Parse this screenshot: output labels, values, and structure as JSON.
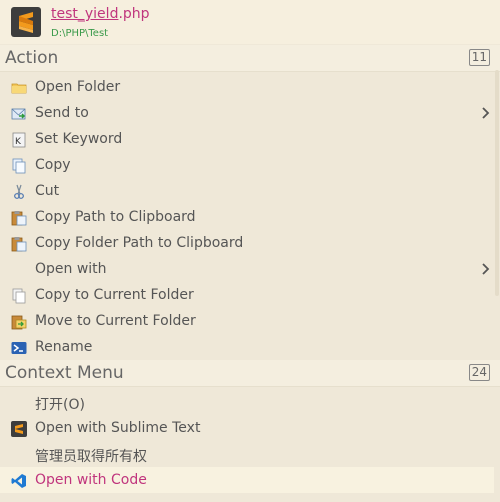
{
  "header": {
    "file_match": "test_yield",
    "file_ext": ".php",
    "path": "D:\\PHP\\Test"
  },
  "sections": [
    {
      "title": "Action",
      "count": "11",
      "items": [
        {
          "label": "Open Folder",
          "icon": "folder-icon"
        },
        {
          "label": "Send to",
          "icon": "send-to-icon",
          "submenu": true
        },
        {
          "label": "Set Keyword",
          "icon": "keyword-icon"
        },
        {
          "label": "Copy",
          "icon": "copy-icon"
        },
        {
          "label": "Cut",
          "icon": "scissors-icon"
        },
        {
          "label": "Copy Path to Clipboard",
          "icon": "clipboard-icon"
        },
        {
          "label": "Copy Folder Path to Clipboard",
          "icon": "clipboard-icon"
        },
        {
          "label": "Open with",
          "icon": "",
          "submenu": true
        },
        {
          "label": "Copy to Current Folder",
          "icon": "copy-icon"
        },
        {
          "label": "Move to Current Folder",
          "icon": "move-icon"
        },
        {
          "label": "Rename",
          "icon": "rename-icon"
        }
      ]
    },
    {
      "title": "Context Menu",
      "count": "24",
      "items": [
        {
          "label": "打开(O)",
          "icon": ""
        },
        {
          "label": "Open with Sublime Text",
          "icon": "sublime-text-icon"
        },
        {
          "label": "管理员取得所有权",
          "icon": ""
        },
        {
          "label": "Open with Code",
          "icon": "vscode-icon",
          "selected": true
        }
      ]
    }
  ],
  "colors": {
    "background": "#efe8d8",
    "highlight": "#c0357d",
    "path_green": "#3a9a4a"
  }
}
